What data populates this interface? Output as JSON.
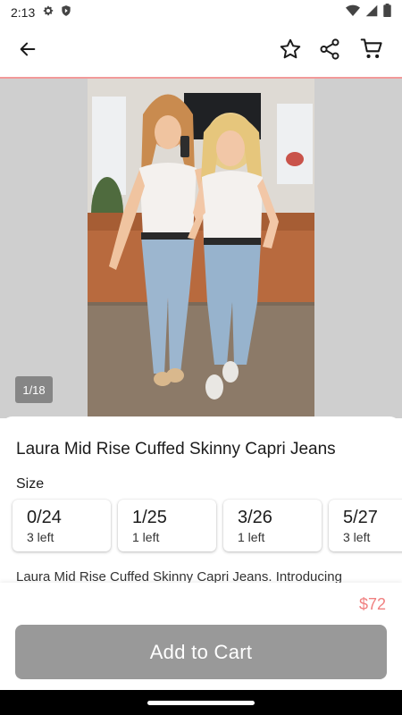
{
  "status_bar": {
    "time": "2:13",
    "icons": [
      "gear-icon",
      "shield-icon",
      "wifi-icon",
      "signal-icon",
      "battery-icon"
    ]
  },
  "app_bar": {
    "icons": [
      "back-arrow-icon",
      "star-icon",
      "share-icon",
      "cart-icon"
    ]
  },
  "gallery": {
    "counter": "1/18"
  },
  "product": {
    "title": "Laura Mid Rise Cuffed Skinny Capri Jeans",
    "size_label": "Size",
    "sizes": [
      {
        "value": "0/24",
        "stock": "3 left"
      },
      {
        "value": "1/25",
        "stock": "1 left"
      },
      {
        "value": "3/26",
        "stock": "1 left"
      },
      {
        "value": "5/27",
        "stock": "3 left"
      }
    ],
    "description": "Laura Mid Rise Cuffed Skinny Capri Jeans. Introducing"
  },
  "footer": {
    "price": "$72",
    "add_to_cart": "Add to Cart"
  },
  "colors": {
    "accent": "#f08080",
    "button": "#999999"
  }
}
